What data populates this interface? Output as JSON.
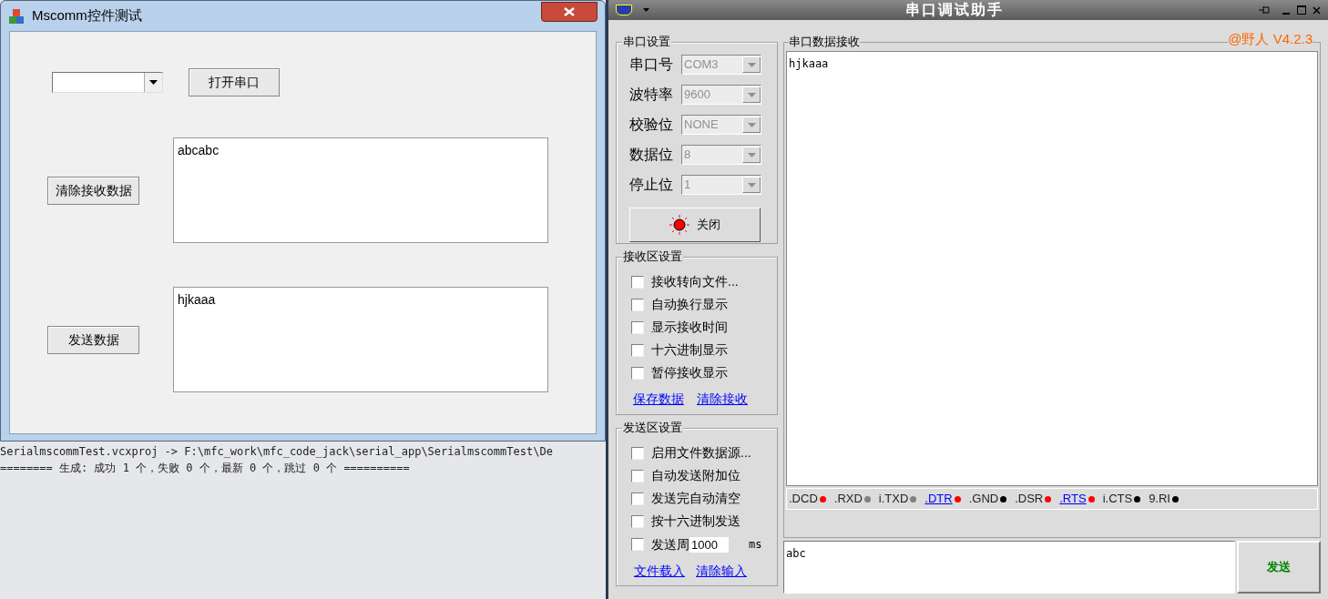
{
  "dialog": {
    "title": "Mscomm控件测试",
    "open_button": "打开串口",
    "clear_button": "清除接收数据",
    "receive_text": "abcabc",
    "send_button": "发送数据",
    "send_text": "hjkaaa"
  },
  "output": {
    "lines": [
      "SerialmscommTest.vcxproj -> F:\\mfc_work\\mfc_code_jack\\serial_app\\SerialmscommTest\\De",
      "======== 生成: 成功 1 个，失败 0 个，最新 0 个，跳过 0 个 =========="
    ]
  },
  "assistant": {
    "title": "串口调试助手",
    "version": "@野人 V4.2.3",
    "port_settings": {
      "title": "串口设置",
      "port_open": true,
      "toggle_button": "关闭",
      "fields": [
        {
          "label": "串口号",
          "value": "COM3",
          "disabled": true
        },
        {
          "label": "波特率",
          "value": "9600",
          "disabled": true
        },
        {
          "label": "校验位",
          "value": "NONE",
          "disabled": true
        },
        {
          "label": "数据位",
          "value": "8",
          "disabled": true
        },
        {
          "label": "停止位",
          "value": "1",
          "disabled": true
        }
      ]
    },
    "receive_settings": {
      "title": "接收区设置",
      "options": [
        {
          "label": "接收转向文件...",
          "checked": false
        },
        {
          "label": "自动换行显示",
          "checked": false
        },
        {
          "label": "显示接收时间",
          "checked": false
        },
        {
          "label": "十六进制显示",
          "checked": false
        },
        {
          "label": "暂停接收显示",
          "checked": false
        }
      ],
      "links": [
        "保存数据",
        "清除接收"
      ]
    },
    "send_settings": {
      "title": "发送区设置",
      "options": [
        {
          "label": "启用文件数据源...",
          "checked": false
        },
        {
          "label": "自动发送附加位",
          "checked": false
        },
        {
          "label": "发送完自动清空",
          "checked": false
        },
        {
          "label": "按十六进制发送",
          "checked": false
        }
      ],
      "period": {
        "label": "发送周",
        "value": "1000",
        "unit": "ms",
        "checked": false
      },
      "links": [
        "文件载入",
        "清除输入"
      ]
    },
    "receive_area": {
      "title": "串口数据接收",
      "text": "hjkaaa"
    },
    "signals": [
      {
        "label": ".DCD",
        "kind": "text",
        "color": "#ff0000"
      },
      {
        "label": ".RXD",
        "kind": "text",
        "color": "#808080"
      },
      {
        "label": "i.TXD",
        "kind": "text",
        "color": "#808080"
      },
      {
        "label": ".DTR",
        "kind": "link",
        "color": "#ff0000"
      },
      {
        "label": ".GND",
        "kind": "text",
        "color": "#000000"
      },
      {
        "label": ".DSR",
        "kind": "text",
        "color": "#ff0000"
      },
      {
        "label": ".RTS",
        "kind": "link",
        "color": "#ff0000"
      },
      {
        "label": "i.CTS",
        "kind": "text",
        "color": "#000000"
      },
      {
        "label": "9.RI",
        "kind": "text",
        "color": "#000000"
      }
    ],
    "send_input": {
      "value": "abc"
    },
    "send_button": "发送"
  }
}
